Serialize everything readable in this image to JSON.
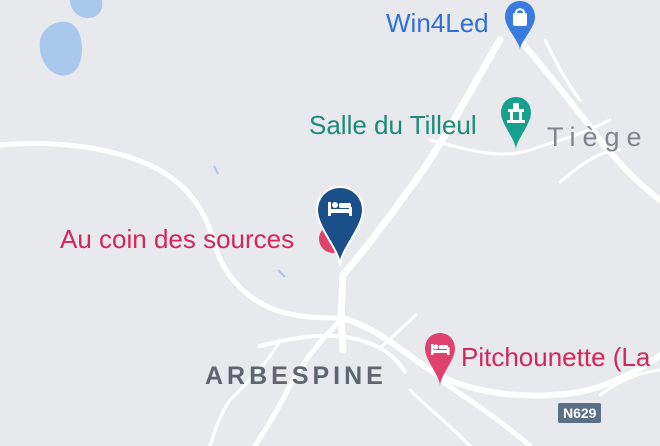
{
  "labels": {
    "win4led": "Win4Led",
    "salle": "Salle du Tilleul",
    "tiege": "Tiège",
    "au_coin": "Au coin des sources",
    "arbespine": "ARBESPINE",
    "pitchounette": "Pitchounette (La"
  },
  "road_shield": "N629",
  "icons": {
    "win4led": "shopping-bag-icon",
    "salle": "landmark-icon",
    "au_coin": "hotel-bed-icon",
    "pitchounette": "hotel-bed-icon"
  },
  "colors": {
    "background": "#e8e9ed",
    "road": "#ffffff",
    "water": "#aac7ec",
    "selected_pin": "#1a4f8a",
    "hotel": "#e0426f",
    "shop": "#3a7be0",
    "landmark": "#17a08c"
  }
}
